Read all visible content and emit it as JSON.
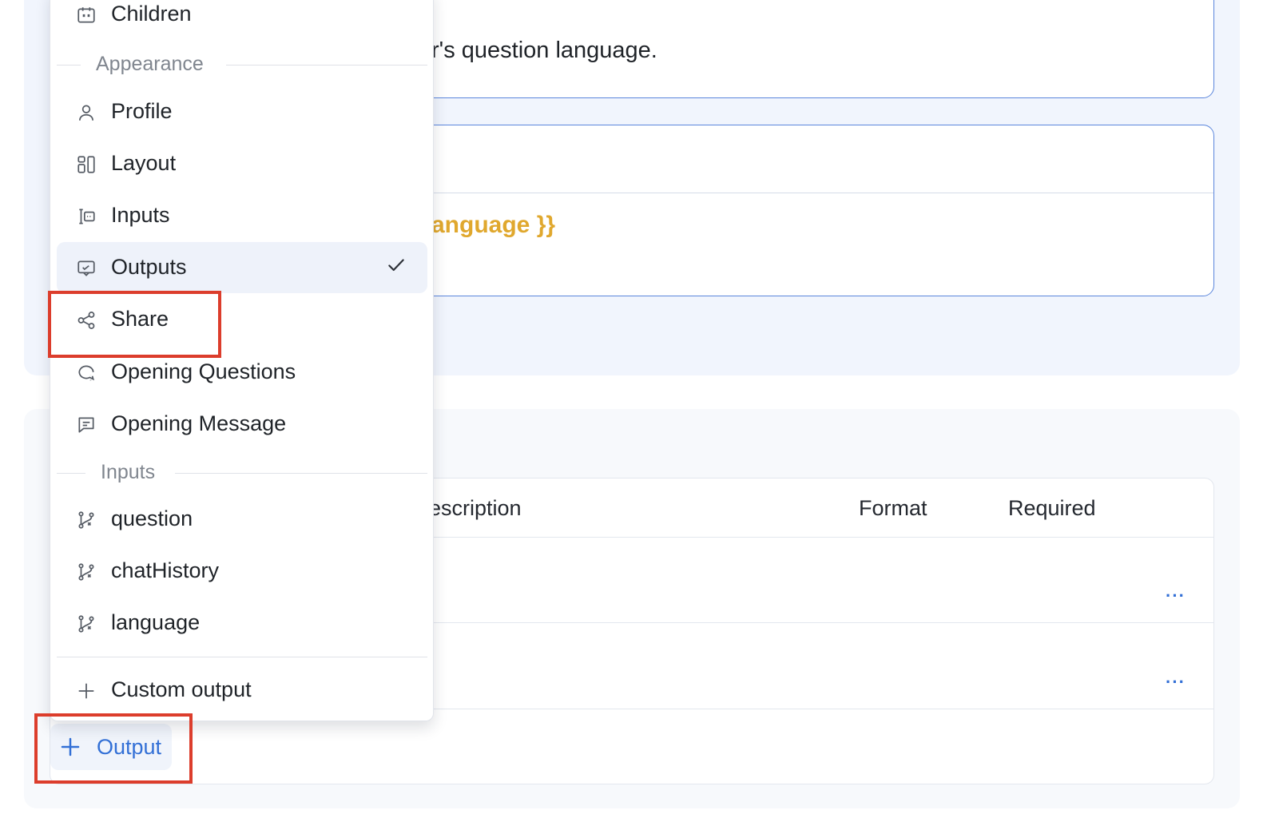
{
  "prompt_card": {
    "text": "r's question language."
  },
  "template_card": {
    "variable_text": "anguage }}"
  },
  "outputs_table": {
    "headers": {
      "description": "escription",
      "format": "Format",
      "required": "Required"
    },
    "rows": [
      {
        "more": "···"
      },
      {
        "more": "···"
      }
    ]
  },
  "add_output_button": {
    "icon": "plus-icon",
    "label": "Output"
  },
  "menu": {
    "top_item": {
      "label": "Children",
      "icon": "calendar-icon"
    },
    "appearance_group": "Appearance",
    "appearance_items": [
      {
        "label": "Profile",
        "icon": "user-icon"
      },
      {
        "label": "Layout",
        "icon": "layout-icon"
      },
      {
        "label": "Inputs",
        "icon": "input-field-icon"
      },
      {
        "label": "Outputs",
        "icon": "output-chat-icon",
        "selected": true
      },
      {
        "label": "Share",
        "icon": "share-icon"
      },
      {
        "label": "Opening Questions",
        "icon": "chat-question-icon"
      },
      {
        "label": "Opening Message",
        "icon": "message-icon"
      }
    ],
    "inputs_group": "Inputs",
    "input_items": [
      {
        "label": "question",
        "icon": "variable-branch-icon"
      },
      {
        "label": "chatHistory",
        "icon": "variable-branch-icon"
      },
      {
        "label": "language",
        "icon": "variable-branch-icon"
      }
    ],
    "custom_output": {
      "label": "Custom output",
      "icon": "plus-icon"
    }
  },
  "colors": {
    "accent": "#3370d6",
    "highlight": "#dc3d2c",
    "variable": "#e0a82e",
    "card_border": "#5b86dc"
  }
}
